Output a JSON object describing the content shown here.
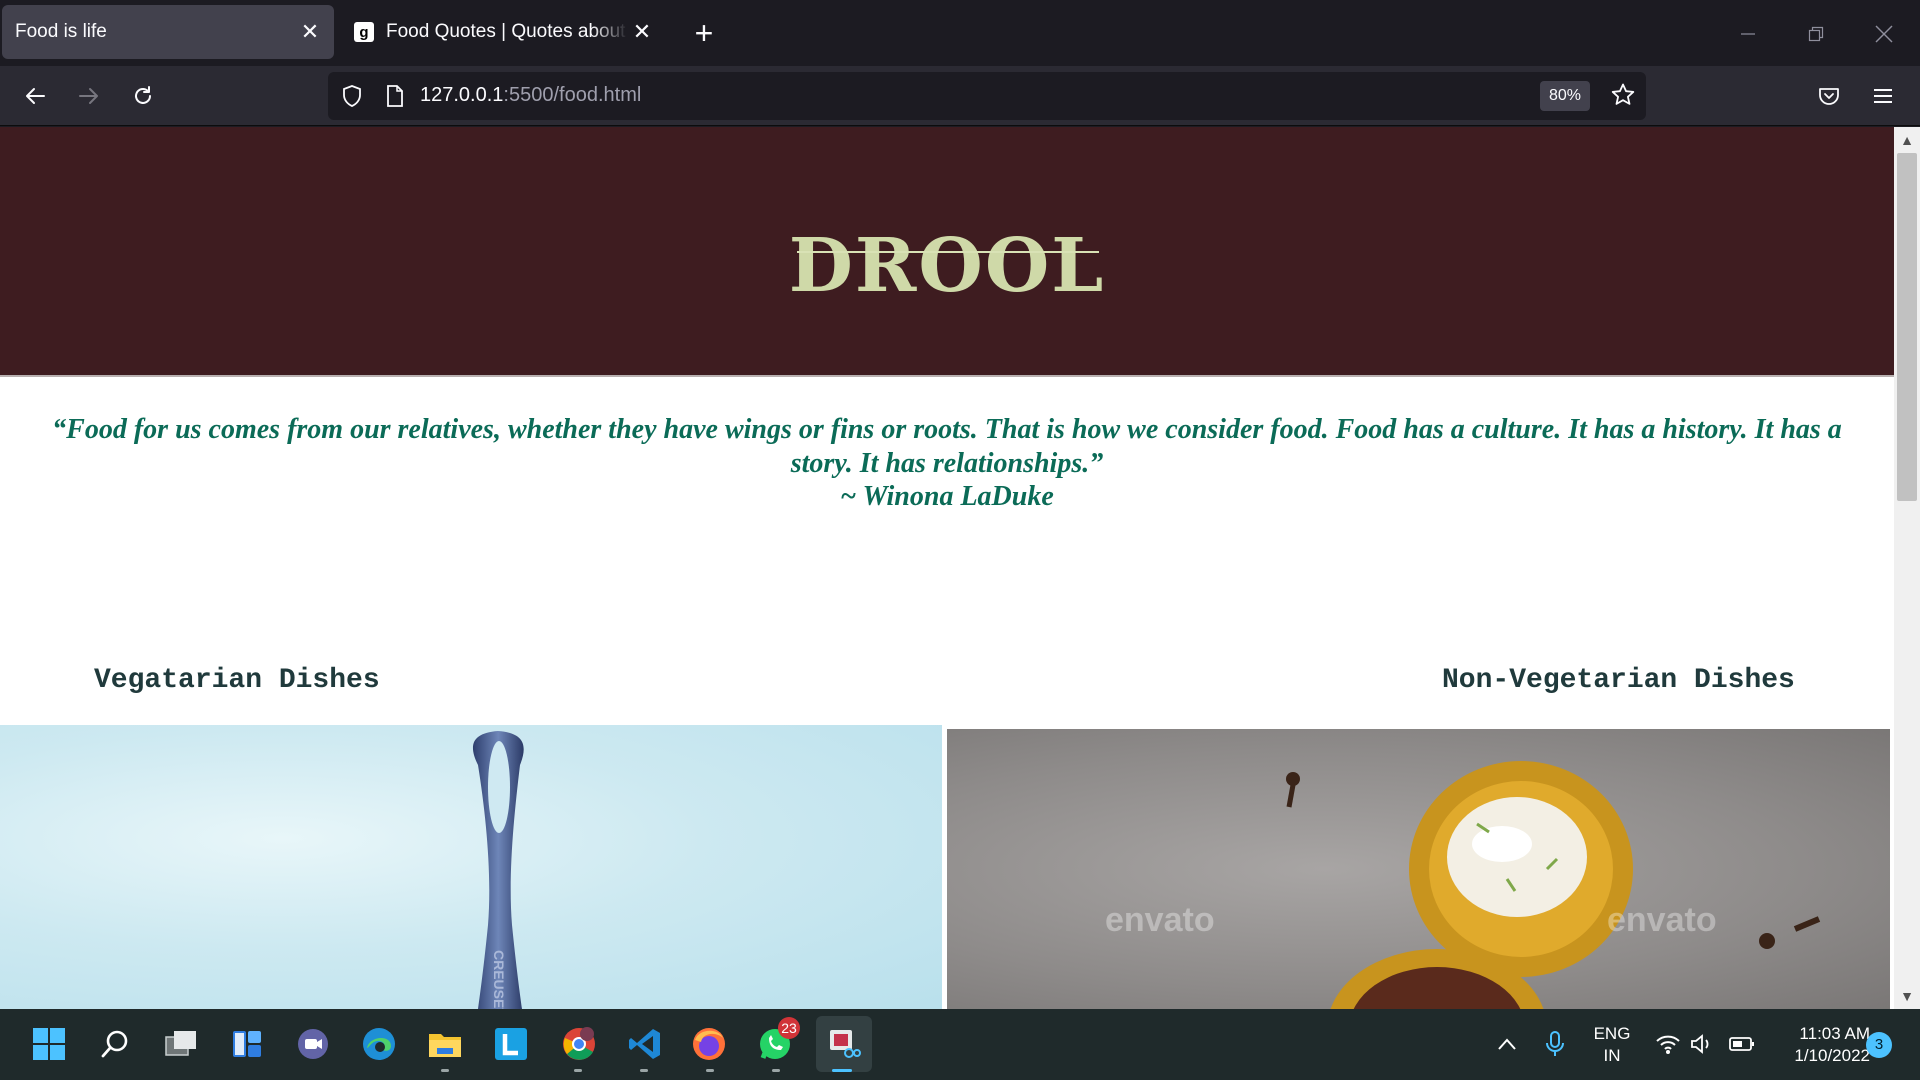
{
  "browser": {
    "tabs": [
      {
        "title": "Food is life",
        "active": true
      },
      {
        "title": "Food Quotes | Quotes about Food",
        "active": false
      }
    ],
    "url_host": "127.0.0.1",
    "url_rest": ":5500/food.html",
    "zoom": "80%"
  },
  "page": {
    "logo": "DROOL",
    "quote": "“Food for us comes from our relatives, whether they have wings or fins or roots. That is how we consider food. Food has a culture. It has a history. It has a story. It has relationships.”",
    "author": "~ Winona LaDuke",
    "veg_title": "Vegatarian Dishes",
    "nonveg_title": "Non-Vegetarian Dishes",
    "watermark": "envato"
  },
  "taskbar": {
    "lang_line1": "ENG",
    "lang_line2": "IN",
    "time": "11:03 AM",
    "date": "1/10/2022",
    "whatsapp_badge": "23",
    "notification_count": "3"
  },
  "colors": {
    "hero_bg": "#3e1c20",
    "logo": "#cfd9a8",
    "quote": "#0b6b57",
    "section_title": "#203a3c"
  }
}
